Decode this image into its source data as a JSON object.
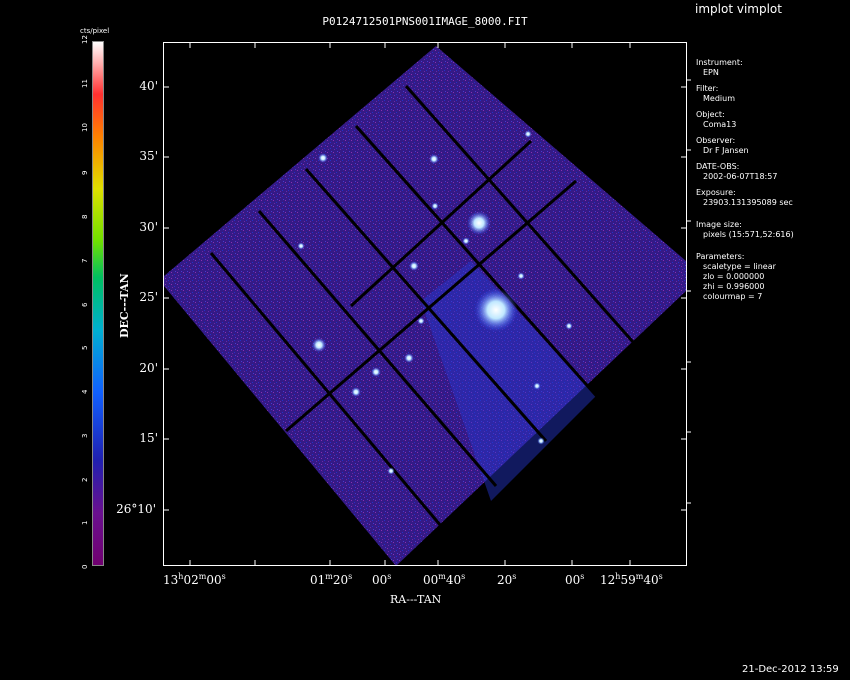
{
  "app_title": "implot vimplot",
  "image_title": "P0124712501PNS001IMAGE_8000.FIT",
  "colorbar": {
    "title": "cts/pixel",
    "ticks": [
      "0",
      "1",
      "2",
      "3",
      "4",
      "5",
      "6",
      "7",
      "8",
      "9",
      "10",
      "11",
      "12"
    ],
    "min": 0,
    "max": 12
  },
  "axes": {
    "ylabel": "DEC---TAN",
    "xlabel": "RA---TAN",
    "yticks": [
      "40'",
      "35'",
      "30'",
      "25'",
      "20'",
      "15'",
      "26°10'"
    ],
    "xticks": [
      "13h02m00s",
      "01m20s",
      "00s",
      "00m40s",
      "20s",
      "00s",
      "12h59m40s"
    ]
  },
  "info": {
    "instrument_label": "Instrument:",
    "instrument": "EPN",
    "filter_label": "Filter:",
    "filter": "Medium",
    "object_label": "Object:",
    "object": "Coma13",
    "observer_label": "Observer:",
    "observer": "Dr F Jansen",
    "date_label": "DATE-OBS:",
    "date": "2002-06-07T18:57",
    "exposure_label": "Exposure:",
    "exposure": "23903.131395089 sec",
    "imgsize_label": "Image size:",
    "imgsize": "pixels (15:571,52:616)",
    "params_label": "Parameters:",
    "scaletype": "scaletype = linear",
    "zlo": "zlo = 0.000000",
    "zhi": "zhi = 0.996000",
    "colourmap": "colourmap =   7"
  },
  "timestamp": "21-Dec-2012 13:59",
  "colors": {
    "bg": "#000000",
    "field": "#3a1a8a",
    "grid": "#000000"
  }
}
